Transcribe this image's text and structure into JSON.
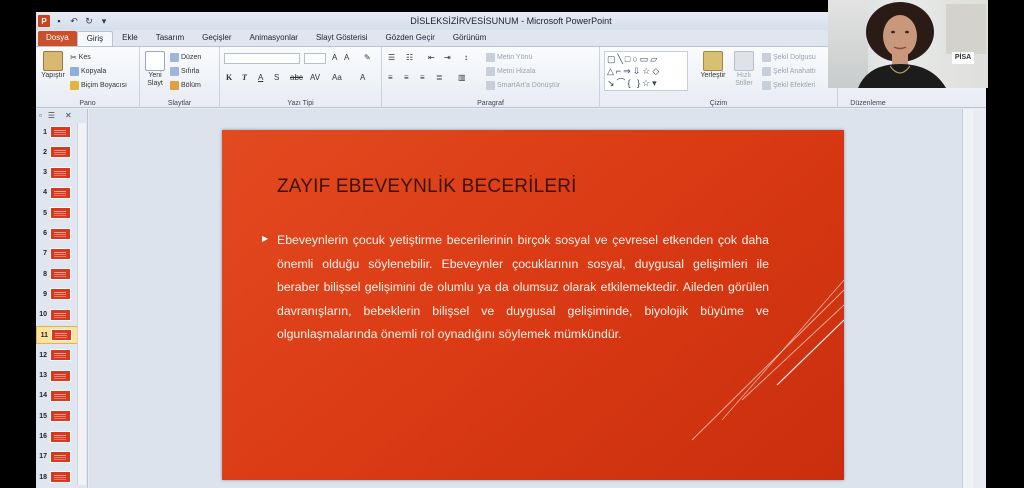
{
  "window": {
    "title": "DİSLEKSİZİRVESİSUNUM - Microsoft PowerPoint"
  },
  "tabs": [
    "Dosya",
    "Giriş",
    "Ekle",
    "Tasarım",
    "Geçişler",
    "Animasyonlar",
    "Slayt Gösterisi",
    "Gözden Geçir",
    "Görünüm"
  ],
  "active_tab": "Giriş",
  "ribbon": {
    "pano": {
      "label": "Pano",
      "paste": "Yapıştır",
      "cut": "Kes",
      "copy": "Kopyala",
      "format_painter": "Biçim Boyacısı"
    },
    "slaytlar": {
      "label": "Slaytlar",
      "new_slide": "Yeni Slayt",
      "layout": "Düzen",
      "reset": "Sıfırla",
      "section": "Bölüm"
    },
    "yazi_tipi": {
      "label": "Yazı Tipi"
    },
    "paragraf": {
      "label": "Paragraf",
      "text_direction": "Metin Yönü",
      "align_text": "Metni Hizala",
      "smartart": "SmartArt'a Dönüştür"
    },
    "cizim": {
      "label": "Çizim",
      "arrange": "Yerleştir",
      "quick_styles": "Hızlı Stiller",
      "shape_fill": "Şekil Dolgusu",
      "shape_outline": "Şekil Anahattı",
      "shape_effects": "Şekil Efektleri"
    },
    "duzenleme": {
      "label": "Düzenleme"
    }
  },
  "slides": {
    "numbers": [
      "1",
      "2",
      "3",
      "4",
      "5",
      "6",
      "7",
      "8",
      "9",
      "10",
      "11",
      "12",
      "13",
      "14",
      "15",
      "16",
      "17",
      "18"
    ],
    "selected": "11"
  },
  "current_slide": {
    "title": "ZAYIF EBEVEYNLİK BECERİLERİ",
    "body": "Ebeveynlerin çocuk yetiştirme becerilerinin birçok sosyal ve çevresel etkenden çok daha önemli olduğu söylenebilir. Ebeveynler çocuklarının sosyal, duygusal gelişimleri ile beraber bilişsel gelişimini de olumlu ya da olumsuz olarak etkilemektedir. Aileden görülen davranışların, bebeklerin bilişsel ve duygusal gelişiminde, biyolojik büyüme ve olgunlaşmalarında önemli rol oynadığını söylemek mümkündür."
  },
  "webcam": {
    "sign_text": "PİSA"
  },
  "colors": {
    "slide_bg": "#dc3c16",
    "file_tab": "#c9502a",
    "title_text": "#3a1208"
  }
}
